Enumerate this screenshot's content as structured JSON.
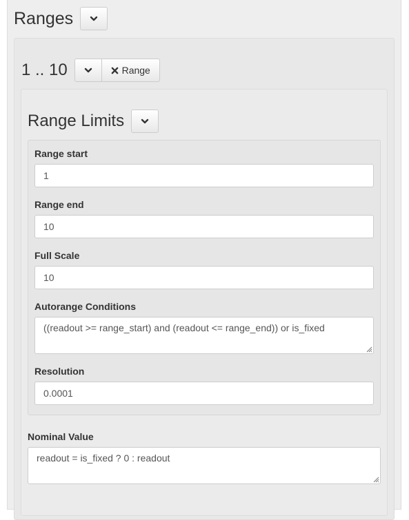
{
  "ranges_section": {
    "title": "Ranges",
    "toggle_icon": "chevron-down-icon"
  },
  "range_item": {
    "title": "1 .. 10",
    "toggle_icon": "chevron-down-icon",
    "remove_icon": "times-icon",
    "remove_label": "Range"
  },
  "range_limits": {
    "title": "Range Limits",
    "toggle_icon": "chevron-down-icon",
    "fields": {
      "range_start": {
        "label": "Range start",
        "value": "1"
      },
      "range_end": {
        "label": "Range end",
        "value": "10"
      },
      "full_scale": {
        "label": "Full Scale",
        "value": "10"
      },
      "autorange_conditions": {
        "label": "Autorange Conditions",
        "value": "((readout >= range_start) and (readout <= range_end)) or is_fixed"
      },
      "resolution": {
        "label": "Resolution",
        "value": "0.0001"
      }
    }
  },
  "nominal_value": {
    "label": "Nominal Value",
    "value": "readout = is_fixed ? 0 : readout"
  }
}
